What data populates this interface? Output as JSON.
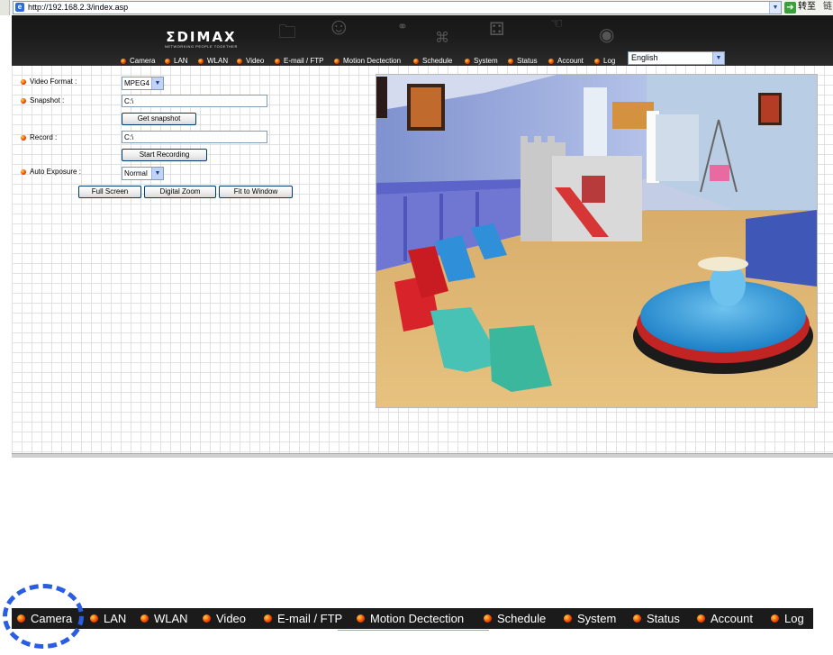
{
  "browser": {
    "url": "http://192.168.2.3/index.asp",
    "go_label": "转至",
    "links_label": "链"
  },
  "header": {
    "brand": "ΣDIMAX",
    "tagline": "NETWORKING PEOPLE TOGETHER"
  },
  "nav": {
    "items": [
      "Camera",
      "LAN",
      "WLAN",
      "Video",
      "E-mail / FTP",
      "Motion Dectection",
      "Schedule",
      "System",
      "Status",
      "Account",
      "Log"
    ],
    "language": "English"
  },
  "form": {
    "video_format": {
      "label": "Video Format :",
      "value": "MPEG4"
    },
    "snapshot": {
      "label": "Snapshot :",
      "path": "C:\\",
      "button": "Get snapshot"
    },
    "record": {
      "label": "Record :",
      "path": "C:\\",
      "button": "Start Recording"
    },
    "auto_exposure": {
      "label": "Auto Exposure :",
      "value": "Normal"
    },
    "view_buttons": [
      "Full Screen",
      "Digital Zoom",
      "Fit to Window"
    ]
  },
  "zoom_nav": {
    "items": [
      "Camera",
      "LAN",
      "WLAN",
      "Video",
      "E-mail / FTP",
      "Motion Dectection",
      "Schedule",
      "System",
      "Status",
      "Account",
      "Log"
    ]
  },
  "colors": {
    "header_bg": "#1c1c1c",
    "bullet": "#f24a00",
    "highlight": "#2a5de2",
    "button_border": "#003c74"
  }
}
